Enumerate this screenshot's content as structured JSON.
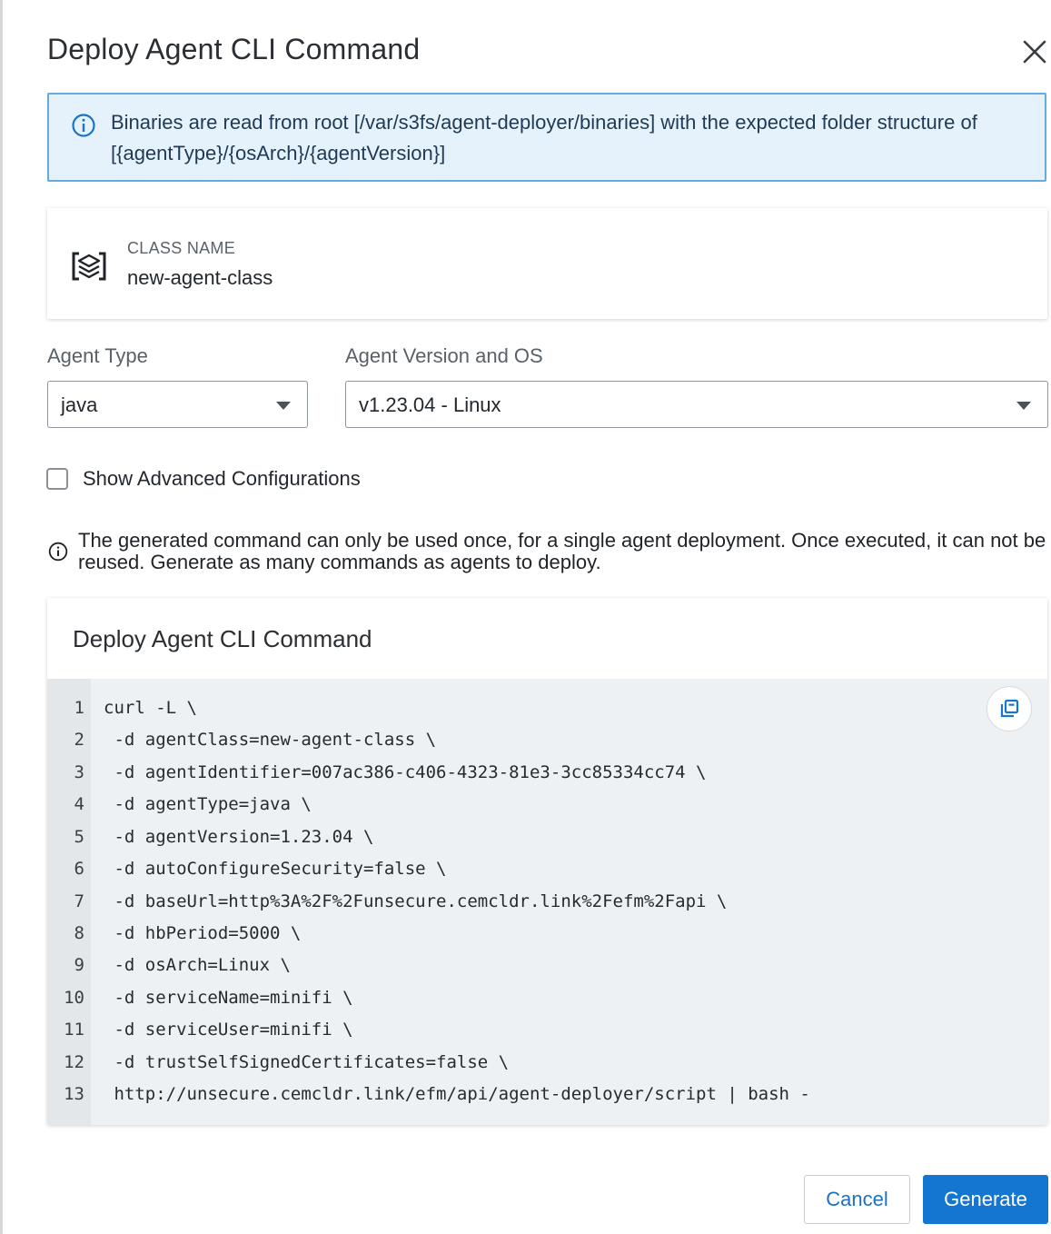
{
  "dialog": {
    "title": "Deploy Agent CLI Command"
  },
  "info_banner": {
    "text": "Binaries are read from root [/var/s3fs/agent-deployer/binaries] with the expected folder structure of [{agentType}/{osArch}/{agentVersion}]",
    "icon": "info-circle-icon"
  },
  "class_card": {
    "label": "CLASS NAME",
    "value": "new-agent-class",
    "icon": "agent-class-icon"
  },
  "agent_type": {
    "label": "Agent Type",
    "value": "java"
  },
  "agent_version": {
    "label": "Agent Version and OS",
    "value": "v1.23.04 - Linux"
  },
  "advanced": {
    "label": "Show Advanced Configurations",
    "checked": false
  },
  "notice": {
    "text": "The generated command can only be used once, for a single agent deployment. Once executed, it can not be reused. Generate as many commands as agents to deploy."
  },
  "command": {
    "title": "Deploy Agent CLI Command",
    "lines": [
      {
        "num": "1",
        "text": "curl -L \\"
      },
      {
        "num": "2",
        "text": " -d agentClass=new-agent-class \\"
      },
      {
        "num": "3",
        "text": " -d agentIdentifier=007ac386-c406-4323-81e3-3cc85334cc74 \\"
      },
      {
        "num": "4",
        "text": " -d agentType=java \\"
      },
      {
        "num": "5",
        "text": " -d agentVersion=1.23.04 \\"
      },
      {
        "num": "6",
        "text": " -d autoConfigureSecurity=false \\"
      },
      {
        "num": "7",
        "text": " -d baseUrl=http%3A%2F%2Funsecure.cemcldr.link%2Fefm%2Fapi \\"
      },
      {
        "num": "8",
        "text": " -d hbPeriod=5000 \\"
      },
      {
        "num": "9",
        "text": " -d osArch=Linux \\"
      },
      {
        "num": "10",
        "text": " -d serviceName=minifi \\"
      },
      {
        "num": "11",
        "text": " -d serviceUser=minifi \\"
      },
      {
        "num": "12",
        "text": " -d trustSelfSignedCertificates=false \\"
      },
      {
        "num": "13",
        "text": " http://unsecure.cemcldr.link/efm/api/agent-deployer/script | bash -"
      }
    ]
  },
  "buttons": {
    "cancel": "Cancel",
    "generate": "Generate"
  },
  "colors": {
    "primary": "#1476d1",
    "banner_bg": "#e5f2fb",
    "banner_border": "#62ace0",
    "code_bg": "#eef1f3"
  }
}
